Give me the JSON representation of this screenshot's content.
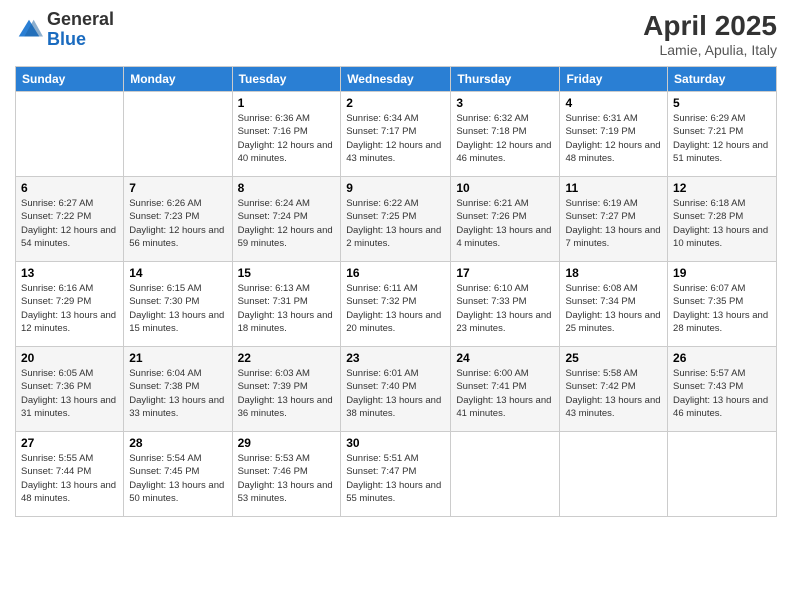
{
  "header": {
    "logo_general": "General",
    "logo_blue": "Blue",
    "month_title": "April 2025",
    "location": "Lamie, Apulia, Italy"
  },
  "weekdays": [
    "Sunday",
    "Monday",
    "Tuesday",
    "Wednesday",
    "Thursday",
    "Friday",
    "Saturday"
  ],
  "weeks": [
    [
      {
        "day": "",
        "info": ""
      },
      {
        "day": "",
        "info": ""
      },
      {
        "day": "1",
        "info": "Sunrise: 6:36 AM\nSunset: 7:16 PM\nDaylight: 12 hours and 40 minutes."
      },
      {
        "day": "2",
        "info": "Sunrise: 6:34 AM\nSunset: 7:17 PM\nDaylight: 12 hours and 43 minutes."
      },
      {
        "day": "3",
        "info": "Sunrise: 6:32 AM\nSunset: 7:18 PM\nDaylight: 12 hours and 46 minutes."
      },
      {
        "day": "4",
        "info": "Sunrise: 6:31 AM\nSunset: 7:19 PM\nDaylight: 12 hours and 48 minutes."
      },
      {
        "day": "5",
        "info": "Sunrise: 6:29 AM\nSunset: 7:21 PM\nDaylight: 12 hours and 51 minutes."
      }
    ],
    [
      {
        "day": "6",
        "info": "Sunrise: 6:27 AM\nSunset: 7:22 PM\nDaylight: 12 hours and 54 minutes."
      },
      {
        "day": "7",
        "info": "Sunrise: 6:26 AM\nSunset: 7:23 PM\nDaylight: 12 hours and 56 minutes."
      },
      {
        "day": "8",
        "info": "Sunrise: 6:24 AM\nSunset: 7:24 PM\nDaylight: 12 hours and 59 minutes."
      },
      {
        "day": "9",
        "info": "Sunrise: 6:22 AM\nSunset: 7:25 PM\nDaylight: 13 hours and 2 minutes."
      },
      {
        "day": "10",
        "info": "Sunrise: 6:21 AM\nSunset: 7:26 PM\nDaylight: 13 hours and 4 minutes."
      },
      {
        "day": "11",
        "info": "Sunrise: 6:19 AM\nSunset: 7:27 PM\nDaylight: 13 hours and 7 minutes."
      },
      {
        "day": "12",
        "info": "Sunrise: 6:18 AM\nSunset: 7:28 PM\nDaylight: 13 hours and 10 minutes."
      }
    ],
    [
      {
        "day": "13",
        "info": "Sunrise: 6:16 AM\nSunset: 7:29 PM\nDaylight: 13 hours and 12 minutes."
      },
      {
        "day": "14",
        "info": "Sunrise: 6:15 AM\nSunset: 7:30 PM\nDaylight: 13 hours and 15 minutes."
      },
      {
        "day": "15",
        "info": "Sunrise: 6:13 AM\nSunset: 7:31 PM\nDaylight: 13 hours and 18 minutes."
      },
      {
        "day": "16",
        "info": "Sunrise: 6:11 AM\nSunset: 7:32 PM\nDaylight: 13 hours and 20 minutes."
      },
      {
        "day": "17",
        "info": "Sunrise: 6:10 AM\nSunset: 7:33 PM\nDaylight: 13 hours and 23 minutes."
      },
      {
        "day": "18",
        "info": "Sunrise: 6:08 AM\nSunset: 7:34 PM\nDaylight: 13 hours and 25 minutes."
      },
      {
        "day": "19",
        "info": "Sunrise: 6:07 AM\nSunset: 7:35 PM\nDaylight: 13 hours and 28 minutes."
      }
    ],
    [
      {
        "day": "20",
        "info": "Sunrise: 6:05 AM\nSunset: 7:36 PM\nDaylight: 13 hours and 31 minutes."
      },
      {
        "day": "21",
        "info": "Sunrise: 6:04 AM\nSunset: 7:38 PM\nDaylight: 13 hours and 33 minutes."
      },
      {
        "day": "22",
        "info": "Sunrise: 6:03 AM\nSunset: 7:39 PM\nDaylight: 13 hours and 36 minutes."
      },
      {
        "day": "23",
        "info": "Sunrise: 6:01 AM\nSunset: 7:40 PM\nDaylight: 13 hours and 38 minutes."
      },
      {
        "day": "24",
        "info": "Sunrise: 6:00 AM\nSunset: 7:41 PM\nDaylight: 13 hours and 41 minutes."
      },
      {
        "day": "25",
        "info": "Sunrise: 5:58 AM\nSunset: 7:42 PM\nDaylight: 13 hours and 43 minutes."
      },
      {
        "day": "26",
        "info": "Sunrise: 5:57 AM\nSunset: 7:43 PM\nDaylight: 13 hours and 46 minutes."
      }
    ],
    [
      {
        "day": "27",
        "info": "Sunrise: 5:55 AM\nSunset: 7:44 PM\nDaylight: 13 hours and 48 minutes."
      },
      {
        "day": "28",
        "info": "Sunrise: 5:54 AM\nSunset: 7:45 PM\nDaylight: 13 hours and 50 minutes."
      },
      {
        "day": "29",
        "info": "Sunrise: 5:53 AM\nSunset: 7:46 PM\nDaylight: 13 hours and 53 minutes."
      },
      {
        "day": "30",
        "info": "Sunrise: 5:51 AM\nSunset: 7:47 PM\nDaylight: 13 hours and 55 minutes."
      },
      {
        "day": "",
        "info": ""
      },
      {
        "day": "",
        "info": ""
      },
      {
        "day": "",
        "info": ""
      }
    ]
  ]
}
